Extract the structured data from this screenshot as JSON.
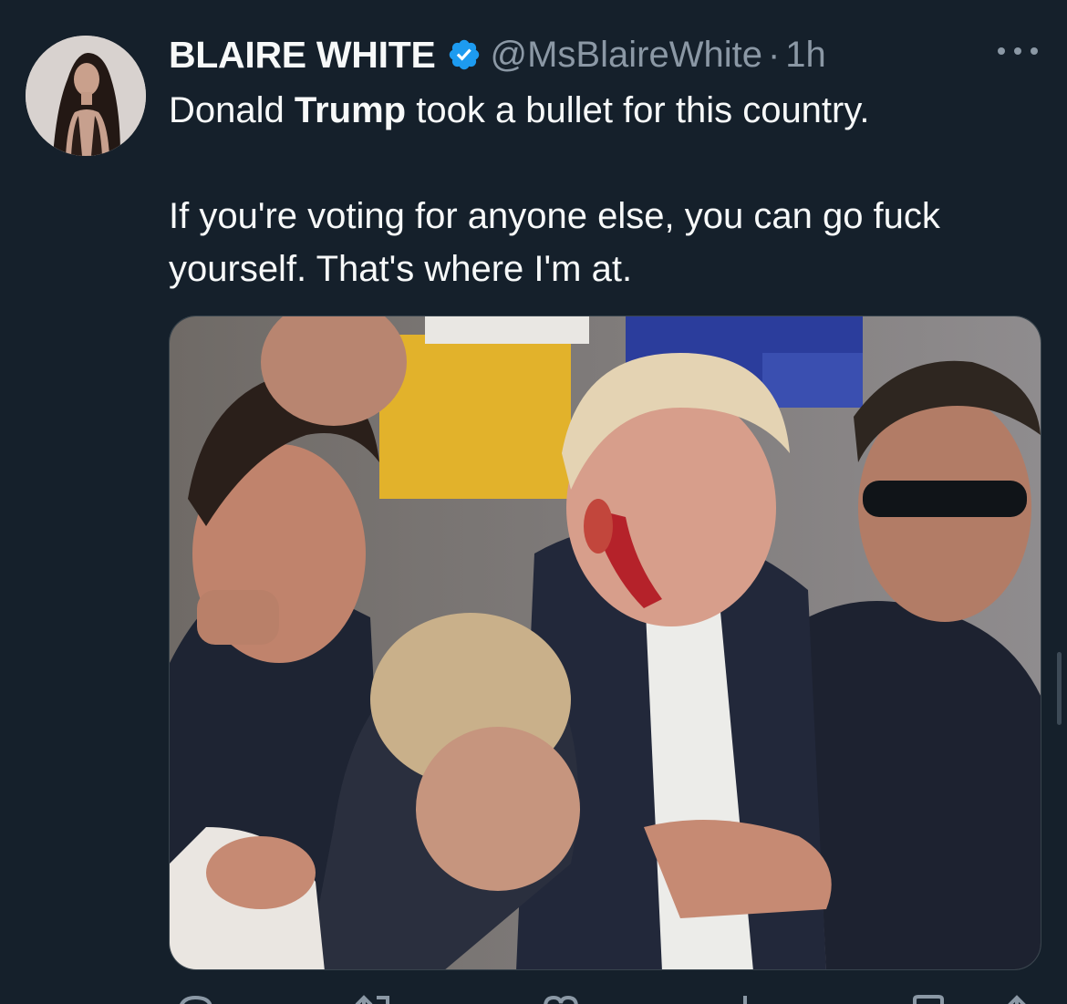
{
  "tweet": {
    "display_name": "BLAIRE WHITE",
    "handle": "@MsBlaireWhite",
    "separator": "·",
    "time": "1h",
    "line1_prefix": "Donald ",
    "line1_bold": "Trump",
    "line1_suffix": " took a bullet for this country.",
    "line2": "If you're voting for anyone else, you can go fuck yourself. That's where I'm at."
  },
  "icons": {
    "verified": "verified-badge-icon",
    "more": "more-options-icon",
    "reply": "reply-icon",
    "retweet": "retweet-icon",
    "like": "like-icon",
    "views": "views-icon",
    "bookmark": "bookmark-icon",
    "share": "share-icon"
  },
  "colors": {
    "background": "#15202b",
    "primary_text": "#f7f9f9",
    "secondary_text": "#8b98a5",
    "verified_blue": "#1d9bf0"
  }
}
